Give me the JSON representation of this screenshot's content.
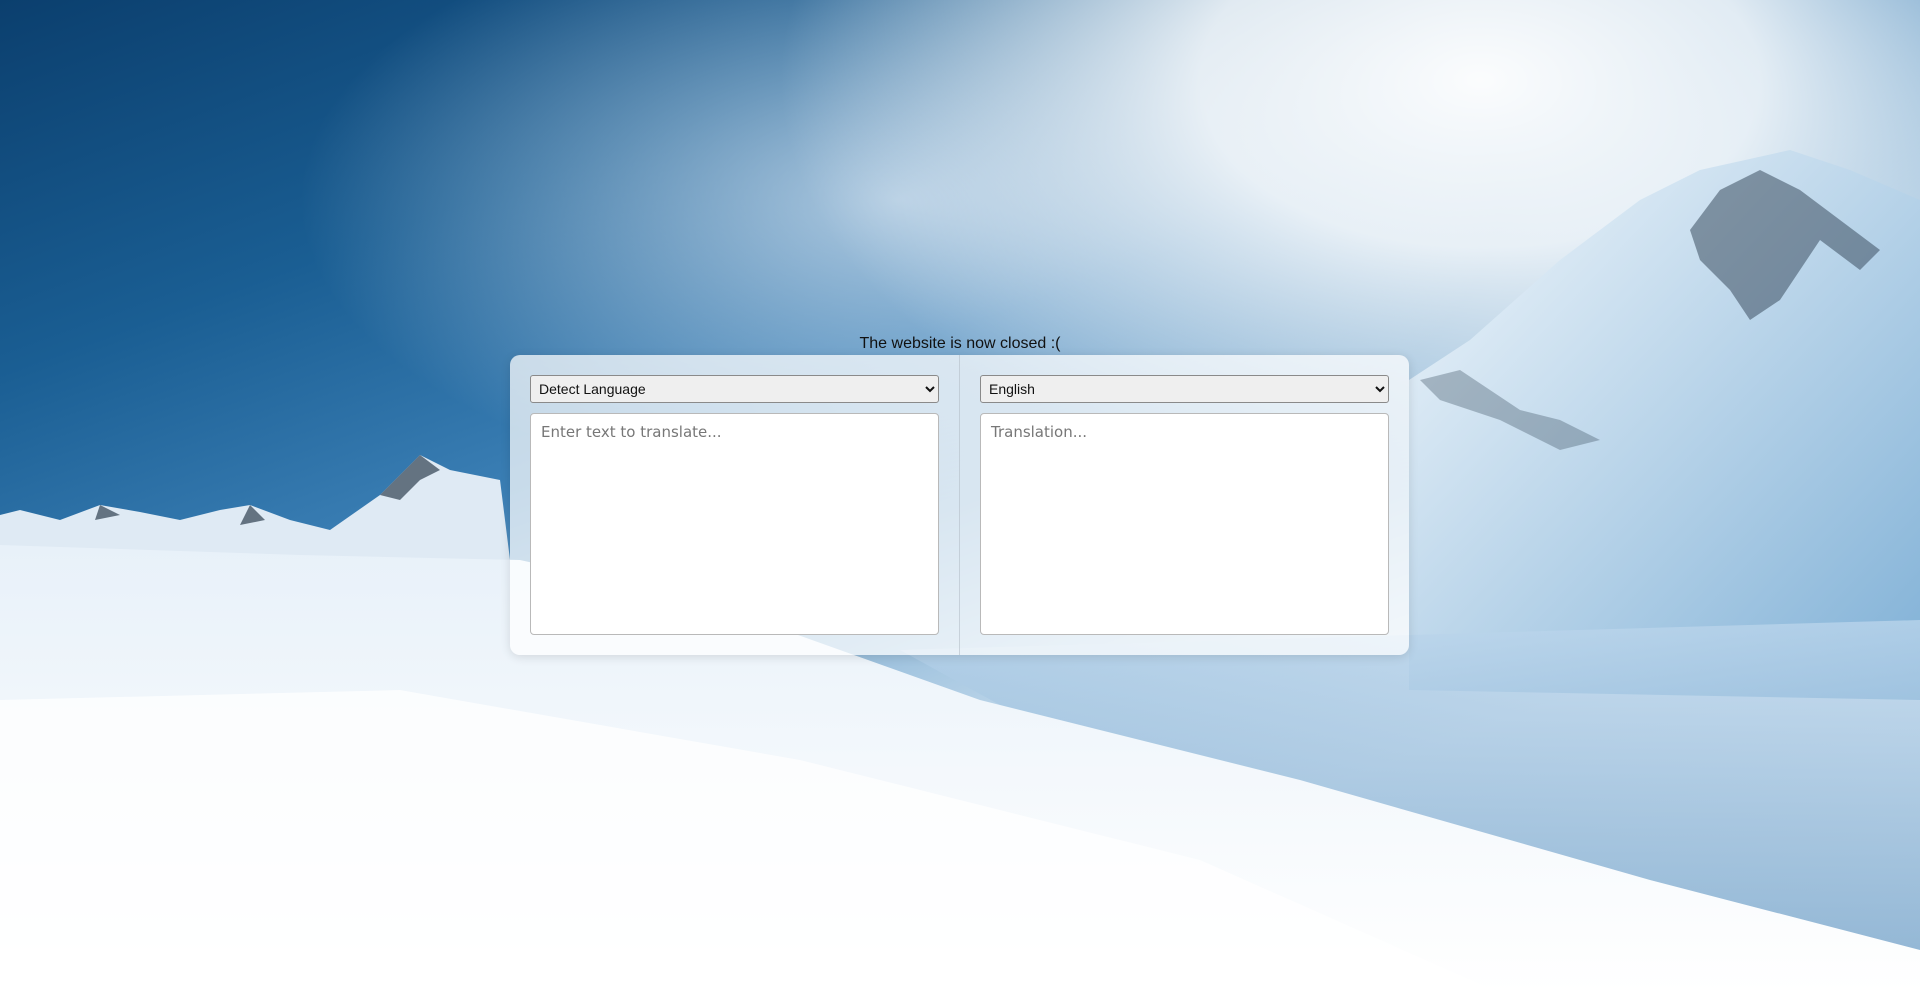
{
  "title": "The website is now closed :(",
  "source": {
    "selected": "Detect Language",
    "placeholder": "Enter text to translate..."
  },
  "target": {
    "selected": "English",
    "placeholder": "Translation..."
  }
}
